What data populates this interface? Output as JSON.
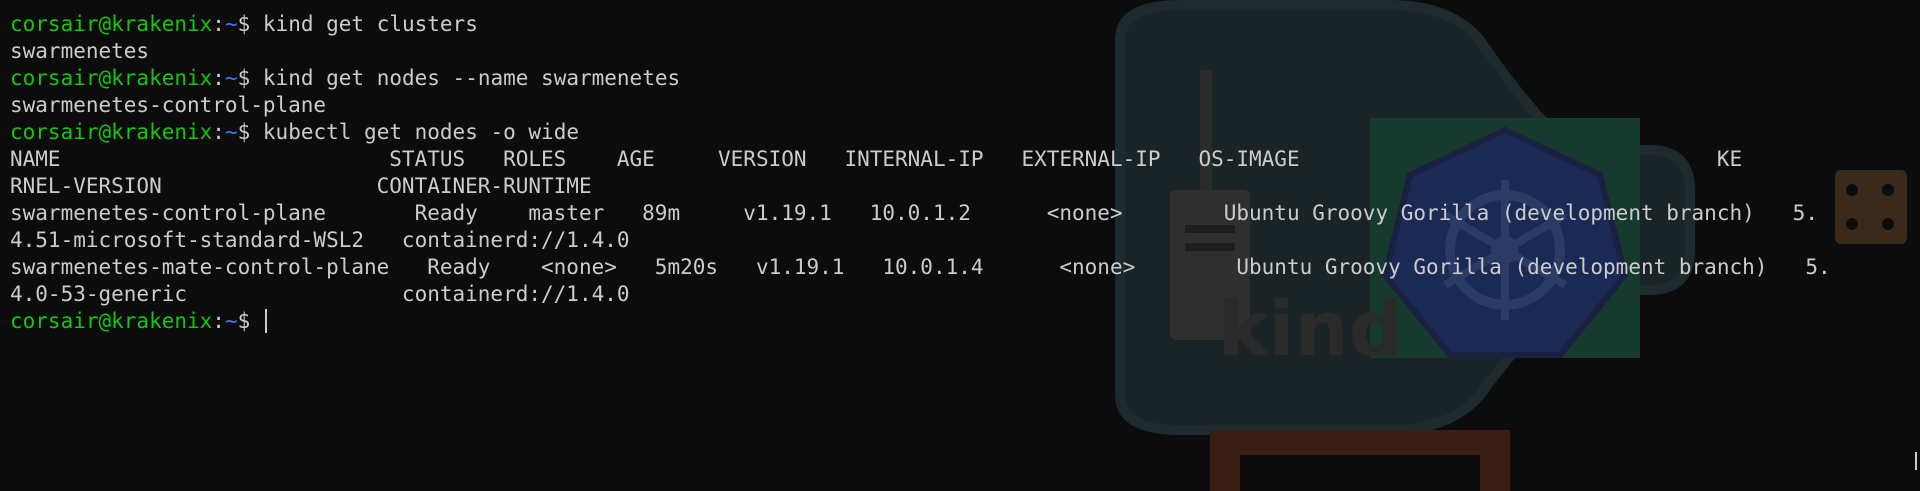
{
  "prompt": {
    "user_host": "corsair@krakenix",
    "separator": ":",
    "path": "~",
    "symbol": "$ "
  },
  "lines": [
    {
      "type": "prompt",
      "command": "kind get clusters"
    },
    {
      "type": "output",
      "text": "swarmenetes"
    },
    {
      "type": "prompt",
      "command": "kind get nodes --name swarmenetes"
    },
    {
      "type": "output",
      "text": "swarmenetes-control-plane"
    },
    {
      "type": "prompt",
      "command": "kubectl get nodes -o wide"
    },
    {
      "type": "output",
      "text": "NAME                          STATUS   ROLES    AGE     VERSION   INTERNAL-IP   EXTERNAL-IP   OS-IMAGE                                 KE"
    },
    {
      "type": "output",
      "text": "RNEL-VERSION                 CONTAINER-RUNTIME"
    },
    {
      "type": "output",
      "text": "swarmenetes-control-plane       Ready    master   89m     v1.19.1   10.0.1.2      <none>        Ubuntu Groovy Gorilla (development branch)   5."
    },
    {
      "type": "output",
      "text": "4.51-microsoft-standard-WSL2   containerd://1.4.0"
    },
    {
      "type": "output",
      "text": "swarmenetes-mate-control-plane   Ready    <none>   5m20s   v1.19.1   10.0.1.4      <none>        Ubuntu Groovy Gorilla (development branch)   5."
    },
    {
      "type": "output",
      "text": "4.0-53-generic                 containerd://1.4.0"
    },
    {
      "type": "prompt",
      "command": ""
    }
  ],
  "watermark": {
    "logo_text": "kind"
  },
  "colors": {
    "background": "#0c0c0c",
    "text": "#cccccc",
    "prompt_user": "#16c60c",
    "prompt_path": "#3b78ff"
  }
}
